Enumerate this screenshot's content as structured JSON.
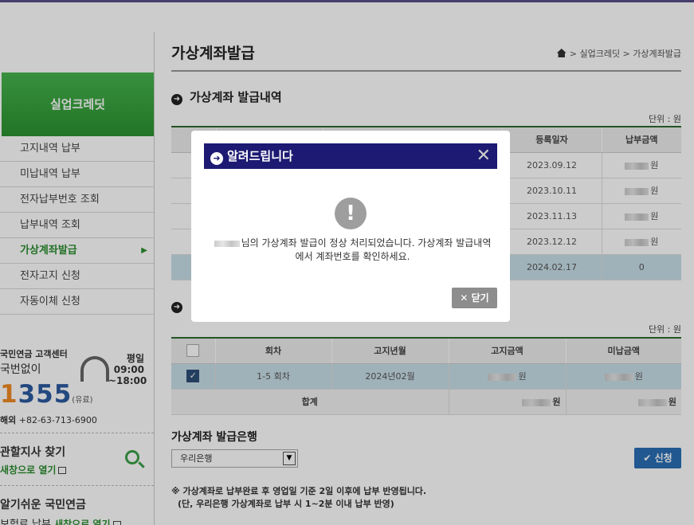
{
  "sidebar": {
    "header": "실업크레딧",
    "items": [
      {
        "label": "고지내역 납부"
      },
      {
        "label": "미납내역 납부"
      },
      {
        "label": "전자납부번호 조회"
      },
      {
        "label": "납부내역 조회"
      },
      {
        "label": "가상계좌발급",
        "active": true
      },
      {
        "label": "전자고지 신청"
      },
      {
        "label": "자동이체 신청"
      }
    ],
    "arrow": "▶",
    "cs": {
      "title": "국민연금 고객센터",
      "sub": "국번없이",
      "num_orange": "1",
      "num_rest": "355",
      "num_paid": "(유료)",
      "hours_day": "평일",
      "hours_start": "09:00",
      "hours_end": "~18:00",
      "overseas_label": "해외",
      "overseas_num": "+82-63-713-6900"
    },
    "quick1": {
      "title": "관할지사 찾기",
      "link": "새창으로 열기"
    },
    "quick2": {
      "title": "알기쉬운 국민연금",
      "sub": "보험료 납부",
      "link": "새창으로 열기"
    }
  },
  "main": {
    "page_title": "가상계좌발급",
    "breadcrumb": "> 실업크레딧 > 가상계좌발급",
    "section1": "가상계좌 발급내역",
    "unit": "단위 : 원",
    "table1": {
      "headers": [
        "",
        "",
        "",
        "등록일자",
        "납부금액"
      ],
      "rows": [
        {
          "date": "2023.09.12",
          "amount": "원"
        },
        {
          "date": "2023.10.11",
          "amount": "원"
        },
        {
          "date": "2023.11.13",
          "amount": "원"
        },
        {
          "date": "2023.12.12",
          "amount": "원"
        },
        {
          "date": "2024.02.17",
          "amount": "0"
        }
      ]
    },
    "unit2": "단위 : 원",
    "table2": {
      "headers": [
        "",
        "회차",
        "고지년월",
        "고지금액",
        "미납금액"
      ],
      "row": {
        "round": "1-5 회차",
        "month": "2024년02월",
        "bill": "원",
        "unpaid": "원"
      },
      "sum_label": "합계",
      "sum_bill": "원",
      "sum_unpaid": "원"
    },
    "bank_title": "가상계좌 발급은행",
    "bank_selected": "우리은행",
    "apply_label": "신청",
    "apply_icon": "✔",
    "note1": "※ 가상계좌로 납부완료 후 영업일 기준 2일 이후에 납부 반영됩니다.",
    "note2": "(단, 우리은행 가상계좌로 납부 시 1~2분 이내 납부 반영)"
  },
  "modal": {
    "title": "알려드립니다",
    "close_x": "✕",
    "warn": "!",
    "message1": "님의 가상계좌 발급이 정상 처리되었습니다. 가상계좌 발급내역",
    "message2": "에서 계좌번호를 확인하세요.",
    "close_label": "닫기",
    "close_icon": "✕"
  },
  "colors": {
    "modal_header": "#1c1a72",
    "accent_green": "#2b8e2f",
    "apply_blue": "#2a6fb4"
  }
}
